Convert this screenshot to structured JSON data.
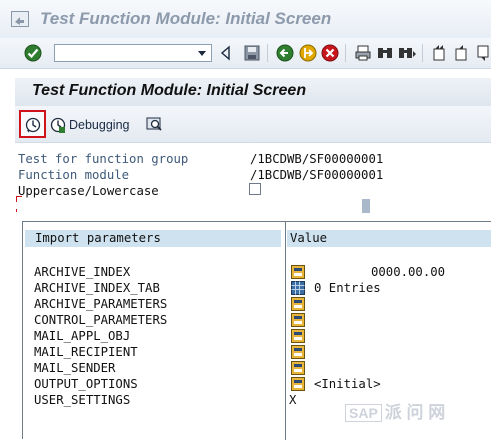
{
  "window": {
    "title": "Test Function Module: Initial Screen"
  },
  "toolbar": {
    "command_field_value": "",
    "icons": [
      "enter-icon",
      "command-dropdown-icon",
      "back-arrow-icon",
      "save-icon",
      "back-icon",
      "exit-icon",
      "cancel-icon",
      "print-icon",
      "find-icon",
      "find-next-icon",
      "first-page-icon",
      "previous-page-icon",
      "next-page-icon"
    ]
  },
  "screen": {
    "title": "Test Function Module: Initial Screen"
  },
  "app_toolbar": {
    "execute_icon": "execute-icon",
    "debugging_label": "Debugging",
    "find_icon": "test-data-directory-icon"
  },
  "form": {
    "function_group_label": "Test for function group",
    "function_group_value": "/1BCDWB/SF00000001",
    "function_module_label": "Function module",
    "function_module_value": "/1BCDWB/SF00000001",
    "uppercase_label": "Uppercase/Lowercase",
    "uppercase_checked": false
  },
  "params": {
    "header_name": "Import parameters",
    "header_value": "Value",
    "rows": [
      {
        "name": "ARCHIVE_INDEX",
        "icon": "structure-icon",
        "value": "0000.00.00"
      },
      {
        "name": "ARCHIVE_INDEX_TAB",
        "icon": "table-icon",
        "value": "0 Entries"
      },
      {
        "name": "ARCHIVE_PARAMETERS",
        "icon": "structure-icon",
        "value": ""
      },
      {
        "name": "CONTROL_PARAMETERS",
        "icon": "structure-icon",
        "value": ""
      },
      {
        "name": "MAIL_APPL_OBJ",
        "icon": "structure-icon",
        "value": ""
      },
      {
        "name": "MAIL_RECIPIENT",
        "icon": "structure-icon",
        "value": ""
      },
      {
        "name": "MAIL_SENDER",
        "icon": "structure-icon",
        "value": ""
      },
      {
        "name": "OUTPUT_OPTIONS",
        "icon": "structure-icon",
        "value": "<Initial>"
      },
      {
        "name": "USER_SETTINGS",
        "icon": "",
        "value": "X"
      }
    ]
  },
  "watermark": {
    "brand": "SAP",
    "text": "派 问 网"
  },
  "colors": {
    "header_highlight": "#cfe2ef",
    "execute_border": "#d0121b",
    "label_blue": "#3f5a7a"
  }
}
